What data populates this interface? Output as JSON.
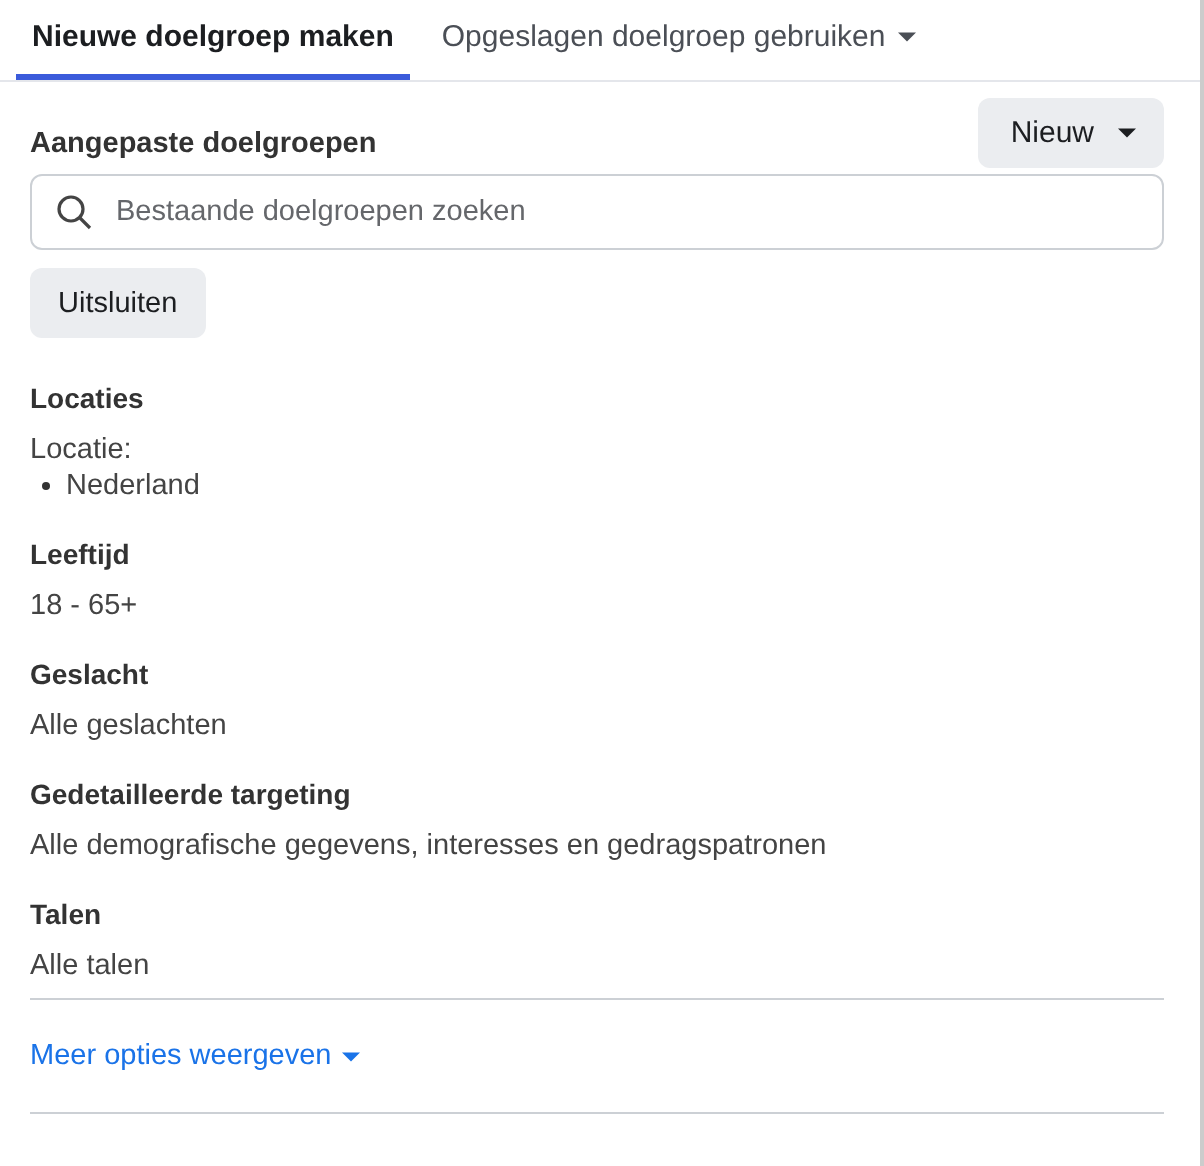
{
  "tabs": [
    {
      "label": "Nieuwe doelgroep maken",
      "selected": true,
      "kind": "plain"
    },
    {
      "label": "Opgeslagen doelgroep gebruiken",
      "selected": false,
      "kind": "dropdown"
    }
  ],
  "custom_audiences": {
    "title": "Aangepaste doelgroepen",
    "new_button": "Nieuw",
    "search": {
      "placeholder": "Bestaande doelgroepen zoeken"
    },
    "exclude_button": "Uitsluiten"
  },
  "sections": [
    {
      "heading": "Locaties",
      "kind": "list",
      "label": "Locatie:",
      "items": [
        "Nederland"
      ]
    },
    {
      "heading": "Leeftijd",
      "kind": "text",
      "value": "18 - 65+"
    },
    {
      "heading": "Geslacht",
      "kind": "text",
      "value": "Alle geslachten"
    },
    {
      "heading": "Gedetailleerde targeting",
      "kind": "text",
      "value": "Alle demografische gegevens, interesses en gedragspatronen"
    },
    {
      "heading": "Talen",
      "kind": "text",
      "value": "Alle talen"
    }
  ],
  "more_options": "Meer opties weergeven"
}
